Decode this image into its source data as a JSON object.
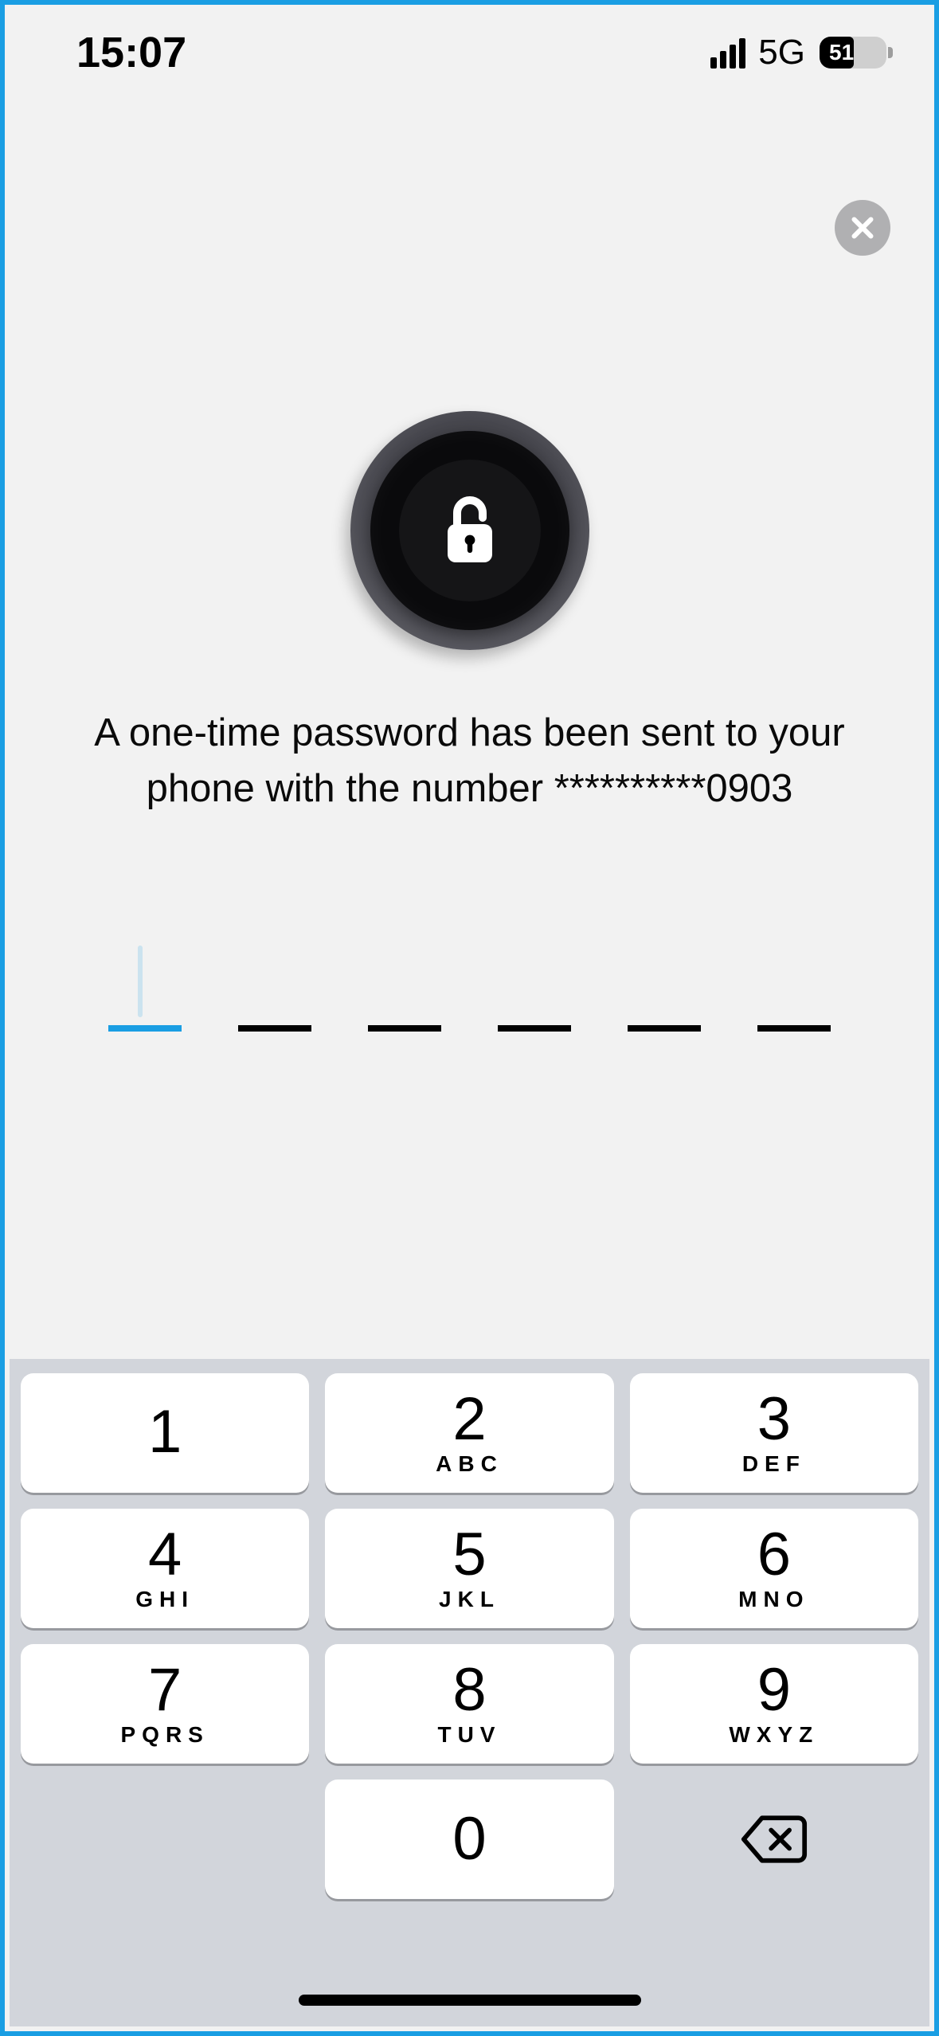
{
  "status_bar": {
    "time": "15:07",
    "network_type": "5G",
    "battery_percent": "51"
  },
  "close_button": {
    "name": "close-icon"
  },
  "otp": {
    "message": "A one-time password has been sent to your phone with the number **********0903",
    "digits_total": 6,
    "active_index": 0
  },
  "keypad": {
    "keys": [
      {
        "digit": "1",
        "letters": ""
      },
      {
        "digit": "2",
        "letters": "ABC"
      },
      {
        "digit": "3",
        "letters": "DEF"
      },
      {
        "digit": "4",
        "letters": "GHI"
      },
      {
        "digit": "5",
        "letters": "JKL"
      },
      {
        "digit": "6",
        "letters": "MNO"
      },
      {
        "digit": "7",
        "letters": "PQRS"
      },
      {
        "digit": "8",
        "letters": "TUV"
      },
      {
        "digit": "9",
        "letters": "WXYZ"
      },
      {
        "digit": "0",
        "letters": ""
      }
    ]
  }
}
